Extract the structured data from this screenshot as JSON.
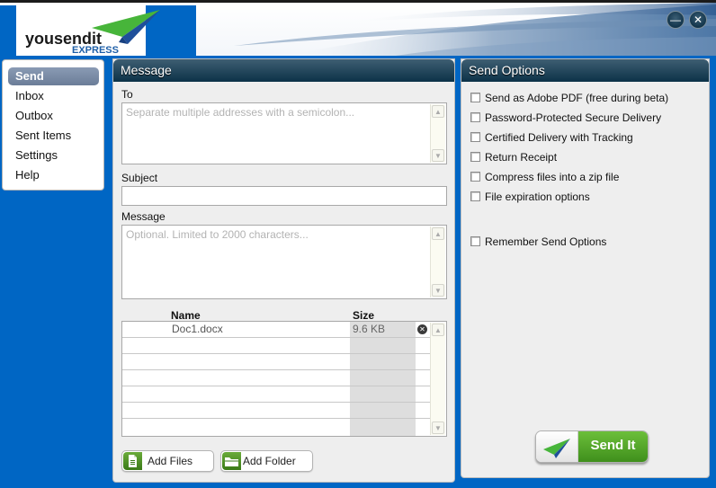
{
  "app": {
    "brand": "yousendit",
    "product": "EXPRESS",
    "window_controls": {
      "minimize_icon": "minimize-icon",
      "close_icon": "close-icon",
      "minimize_glyph": "—",
      "close_glyph": "✕"
    }
  },
  "sidebar": {
    "items": [
      {
        "label": "Send",
        "active": true
      },
      {
        "label": "Inbox",
        "active": false
      },
      {
        "label": "Outbox",
        "active": false
      },
      {
        "label": "Sent Items",
        "active": false
      },
      {
        "label": "Settings",
        "active": false
      },
      {
        "label": "Help",
        "active": false
      }
    ]
  },
  "message_panel": {
    "title": "Message",
    "to": {
      "label": "To",
      "value": "",
      "placeholder": "Separate multiple addresses with a semicolon..."
    },
    "subject": {
      "label": "Subject",
      "value": ""
    },
    "message": {
      "label": "Message",
      "value": "",
      "placeholder": "Optional. Limited to 2000 characters..."
    },
    "files": {
      "columns": [
        "Name",
        "Size"
      ],
      "rows": [
        {
          "name": "Doc1.docx",
          "size": "9.6 KB",
          "remove_glyph": "✕"
        }
      ],
      "empty_rows": 6
    },
    "add_files_label": "Add Files",
    "add_folder_label": "Add Folder"
  },
  "options_panel": {
    "title": "Send Options",
    "options": [
      {
        "label": "Send as Adobe PDF (free during beta)",
        "checked": false
      },
      {
        "label": "Password-Protected Secure Delivery",
        "checked": false
      },
      {
        "label": "Certified Delivery with Tracking",
        "checked": false
      },
      {
        "label": "Return Receipt",
        "checked": false
      },
      {
        "label": "Compress files into a zip file",
        "checked": false
      },
      {
        "label": "File expiration options",
        "checked": false
      }
    ],
    "remember": {
      "label": "Remember Send Options",
      "checked": false
    },
    "send_label": "Send It"
  },
  "colors": {
    "background_blue": "#0066c4",
    "panel_header": "#0c3248",
    "send_green": "#4e9f26",
    "nav_active": "#7487a3"
  }
}
